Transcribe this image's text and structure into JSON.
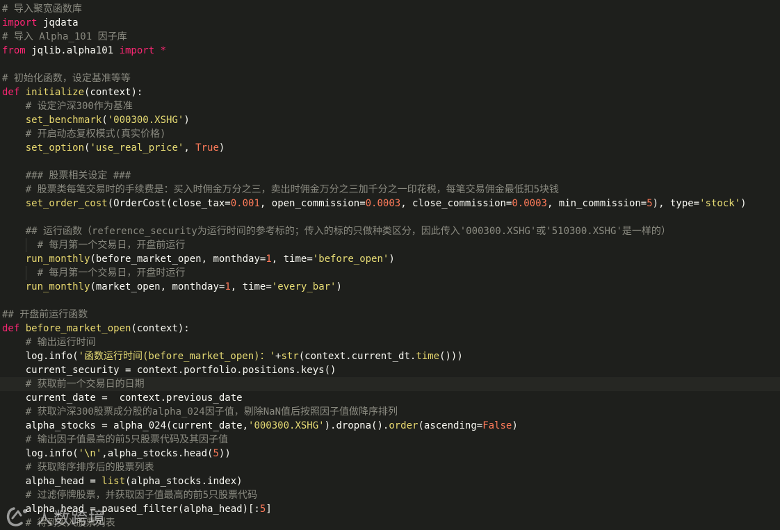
{
  "theme": {
    "background": "#1e1f1c",
    "keyword": "#f92672",
    "comment": "#8a8a80",
    "string": "#e6db74",
    "number": "#fd7a59",
    "function": "#e8d86f",
    "text": "#f8f8f2"
  },
  "lines": [
    {
      "tokens": [
        {
          "t": "cmt",
          "v": "# 导入聚宽函数库"
        }
      ]
    },
    {
      "tokens": [
        {
          "t": "kw",
          "v": "import"
        },
        {
          "t": "plain",
          "v": " jqdata"
        }
      ]
    },
    {
      "tokens": [
        {
          "t": "cmt",
          "v": "# 导入 Alpha_101 因子库"
        }
      ]
    },
    {
      "tokens": [
        {
          "t": "kw",
          "v": "from"
        },
        {
          "t": "plain",
          "v": " jqlib.alpha101 "
        },
        {
          "t": "kw",
          "v": "import"
        },
        {
          "t": "plain",
          "v": " "
        },
        {
          "t": "kw",
          "v": "*"
        }
      ]
    },
    {
      "tokens": []
    },
    {
      "tokens": [
        {
          "t": "cmt",
          "v": "# 初始化函数，设定基准等等"
        }
      ]
    },
    {
      "tokens": [
        {
          "t": "kw",
          "v": "def"
        },
        {
          "t": "plain",
          "v": " "
        },
        {
          "t": "fn",
          "v": "initialize"
        },
        {
          "t": "plain",
          "v": "(context):"
        }
      ]
    },
    {
      "tokens": [
        {
          "t": "plain",
          "v": "    "
        },
        {
          "t": "cmt",
          "v": "# 设定沪深300作为基准"
        }
      ]
    },
    {
      "tokens": [
        {
          "t": "plain",
          "v": "    "
        },
        {
          "t": "fn",
          "v": "set_benchmark"
        },
        {
          "t": "plain",
          "v": "("
        },
        {
          "t": "str",
          "v": "'000300.XSHG'"
        },
        {
          "t": "plain",
          "v": ")"
        }
      ]
    },
    {
      "tokens": [
        {
          "t": "plain",
          "v": "    "
        },
        {
          "t": "cmt",
          "v": "# 开启动态复权模式(真实价格)"
        }
      ]
    },
    {
      "tokens": [
        {
          "t": "plain",
          "v": "    "
        },
        {
          "t": "fn",
          "v": "set_option"
        },
        {
          "t": "plain",
          "v": "("
        },
        {
          "t": "str",
          "v": "'use_real_price'"
        },
        {
          "t": "plain",
          "v": ", "
        },
        {
          "t": "const",
          "v": "True"
        },
        {
          "t": "plain",
          "v": ")"
        }
      ]
    },
    {
      "tokens": []
    },
    {
      "tokens": [
        {
          "t": "plain",
          "v": "    "
        },
        {
          "t": "cmt",
          "v": "### 股票相关设定 ###"
        }
      ]
    },
    {
      "tokens": [
        {
          "t": "plain",
          "v": "    "
        },
        {
          "t": "cmt",
          "v": "# 股票类每笔交易时的手续费是：买入时佣金万分之三，卖出时佣金万分之三加千分之一印花税，每笔交易佣金最低扣5块钱"
        }
      ]
    },
    {
      "tokens": [
        {
          "t": "plain",
          "v": "    "
        },
        {
          "t": "fn",
          "v": "set_order_cost"
        },
        {
          "t": "plain",
          "v": "(OrderCost(close_tax="
        },
        {
          "t": "num",
          "v": "0.001"
        },
        {
          "t": "plain",
          "v": ", open_commission="
        },
        {
          "t": "num",
          "v": "0.0003"
        },
        {
          "t": "plain",
          "v": ", close_commission="
        },
        {
          "t": "num",
          "v": "0.0003"
        },
        {
          "t": "plain",
          "v": ", min_commission="
        },
        {
          "t": "num",
          "v": "5"
        },
        {
          "t": "plain",
          "v": "), type="
        },
        {
          "t": "str",
          "v": "'stock'"
        },
        {
          "t": "plain",
          "v": ")"
        }
      ]
    },
    {
      "tokens": []
    },
    {
      "tokens": [
        {
          "t": "plain",
          "v": "    "
        },
        {
          "t": "cmt",
          "v": "## 运行函数（reference_security为运行时间的参考标的；传入的标的只做种类区分，因此传入'000300.XSHG'或'510300.XSHG'是一样的）"
        }
      ]
    },
    {
      "guide": true,
      "tokens": [
        {
          "t": "plain",
          "v": "      "
        },
        {
          "t": "cmt",
          "v": "# 每月第一个交易日，开盘前运行"
        }
      ]
    },
    {
      "tokens": [
        {
          "t": "plain",
          "v": "    "
        },
        {
          "t": "fn",
          "v": "run_monthly"
        },
        {
          "t": "plain",
          "v": "(before_market_open, monthday="
        },
        {
          "t": "num",
          "v": "1"
        },
        {
          "t": "plain",
          "v": ", time="
        },
        {
          "t": "str",
          "v": "'before_open'"
        },
        {
          "t": "plain",
          "v": ")"
        }
      ]
    },
    {
      "guide": true,
      "tokens": [
        {
          "t": "plain",
          "v": "      "
        },
        {
          "t": "cmt",
          "v": "# 每月第一个交易日，开盘时运行"
        }
      ]
    },
    {
      "tokens": [
        {
          "t": "plain",
          "v": "    "
        },
        {
          "t": "fn",
          "v": "run_monthly"
        },
        {
          "t": "plain",
          "v": "(market_open, monthday="
        },
        {
          "t": "num",
          "v": "1"
        },
        {
          "t": "plain",
          "v": ", time="
        },
        {
          "t": "str",
          "v": "'every_bar'"
        },
        {
          "t": "plain",
          "v": ")"
        }
      ]
    },
    {
      "tokens": []
    },
    {
      "tokens": [
        {
          "t": "cmt",
          "v": "## 开盘前运行函数"
        }
      ]
    },
    {
      "tokens": [
        {
          "t": "kw",
          "v": "def"
        },
        {
          "t": "plain",
          "v": " "
        },
        {
          "t": "fn",
          "v": "before_market_open"
        },
        {
          "t": "plain",
          "v": "(context):"
        }
      ]
    },
    {
      "tokens": [
        {
          "t": "plain",
          "v": "    "
        },
        {
          "t": "cmt",
          "v": "# 输出运行时间"
        }
      ]
    },
    {
      "tokens": [
        {
          "t": "plain",
          "v": "    log.info("
        },
        {
          "t": "str",
          "v": "'函数运行时间(before_market_open)：'"
        },
        {
          "t": "plain",
          "v": "+"
        },
        {
          "t": "fn",
          "v": "str"
        },
        {
          "t": "plain",
          "v": "(context.current_dt."
        },
        {
          "t": "fn",
          "v": "time"
        },
        {
          "t": "plain",
          "v": "()))"
        }
      ]
    },
    {
      "tokens": [
        {
          "t": "plain",
          "v": "    current_security = context.portfolio.positions.keys()"
        }
      ]
    },
    {
      "hl": true,
      "tokens": [
        {
          "t": "plain",
          "v": "    "
        },
        {
          "t": "cmt",
          "v": "# 获取前一个交易日的日期"
        }
      ]
    },
    {
      "tokens": [
        {
          "t": "plain",
          "v": "    current_date =  context.previous_date"
        }
      ]
    },
    {
      "tokens": [
        {
          "t": "plain",
          "v": "    "
        },
        {
          "t": "cmt",
          "v": "# 获取沪深300股票成分股的alpha_024因子值，剔除NaN值后按照因子值做降序排列"
        }
      ]
    },
    {
      "tokens": [
        {
          "t": "plain",
          "v": "    alpha_stocks = alpha_024(current_date,"
        },
        {
          "t": "str",
          "v": "'000300.XSHG'"
        },
        {
          "t": "plain",
          "v": ").dropna()."
        },
        {
          "t": "fn",
          "v": "order"
        },
        {
          "t": "plain",
          "v": "(ascending="
        },
        {
          "t": "const",
          "v": "False"
        },
        {
          "t": "plain",
          "v": ")"
        }
      ]
    },
    {
      "tokens": [
        {
          "t": "plain",
          "v": "    "
        },
        {
          "t": "cmt",
          "v": "# 输出因子值最高的前5只股票代码及其因子值"
        }
      ]
    },
    {
      "tokens": [
        {
          "t": "plain",
          "v": "    log.info("
        },
        {
          "t": "str",
          "v": "'\\n'"
        },
        {
          "t": "plain",
          "v": ",alpha_stocks.head("
        },
        {
          "t": "num",
          "v": "5"
        },
        {
          "t": "plain",
          "v": "))"
        }
      ]
    },
    {
      "tokens": [
        {
          "t": "plain",
          "v": "    "
        },
        {
          "t": "cmt",
          "v": "# 获取降序排序后的股票列表"
        }
      ]
    },
    {
      "tokens": [
        {
          "t": "plain",
          "v": "    alpha_head = "
        },
        {
          "t": "fn",
          "v": "list"
        },
        {
          "t": "plain",
          "v": "(alpha_stocks.index)"
        }
      ]
    },
    {
      "tokens": [
        {
          "t": "plain",
          "v": "    "
        },
        {
          "t": "cmt",
          "v": "# 过滤停牌股票，并获取因子值最高的前5只股票代码"
        }
      ]
    },
    {
      "tokens": [
        {
          "t": "plain",
          "v": "    alpha_head = paused_filter(alpha_head)[:"
        },
        {
          "t": "num",
          "v": "5"
        },
        {
          "t": "plain",
          "v": "]"
        }
      ]
    },
    {
      "tokens": [
        {
          "t": "plain",
          "v": "    "
        },
        {
          "t": "cmt",
          "v": "# 得到买入股票列表"
        }
      ]
    }
  ],
  "watermark": {
    "text": "人数跨境",
    "icon": "watermark-logo-icon"
  }
}
